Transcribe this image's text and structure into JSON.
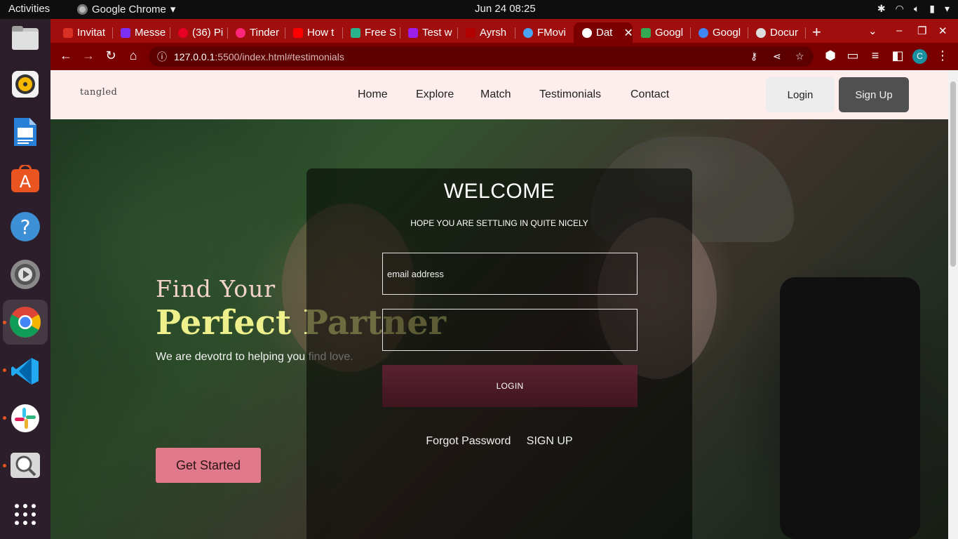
{
  "system": {
    "activities": "Activities",
    "app_name": "Google Chrome",
    "clock": "Jun 24  08:25"
  },
  "dock": [
    {
      "name": "files-icon"
    },
    {
      "name": "rhythmbox-icon"
    },
    {
      "name": "libreoffice-writer-icon"
    },
    {
      "name": "ubuntu-software-icon"
    },
    {
      "name": "help-icon"
    },
    {
      "name": "settings-icon"
    },
    {
      "name": "chrome-icon"
    },
    {
      "name": "vscode-icon"
    },
    {
      "name": "slack-icon"
    },
    {
      "name": "image-viewer-icon"
    },
    {
      "name": "show-apps-icon"
    }
  ],
  "tabs": [
    {
      "label": "Invitat",
      "color": "#d93025"
    },
    {
      "label": "Messe",
      "color": "#7b2ff7"
    },
    {
      "label": "(36) Pi",
      "color": "#e60023"
    },
    {
      "label": "Tinder",
      "color": "#fd267a"
    },
    {
      "label": "How t",
      "color": "#ff0000"
    },
    {
      "label": "Free S",
      "color": "#2bb48c"
    },
    {
      "label": "Test w",
      "color": "#9b1fe8"
    },
    {
      "label": "Ayrsh",
      "color": "#b30000"
    },
    {
      "label": "FMovi",
      "color": "#4aa3f0"
    },
    {
      "label": "Dat",
      "color": "#ffffff"
    },
    {
      "label": "Googl",
      "color": "#34a853"
    },
    {
      "label": "Googl",
      "color": "#4285f4"
    },
    {
      "label": "Docur",
      "color": "#dddddd"
    }
  ],
  "browser": {
    "url_host": "127.0.0.1",
    "url_path": ":5500/index.html#testimonials",
    "profile_initial": "C",
    "accent": "#a00e0e"
  },
  "site": {
    "logo": "tangled",
    "nav": [
      "Home",
      "Explore",
      "Match",
      "Testimonials",
      "Contact"
    ],
    "login_label": "Login",
    "signup_label": "Sign Up"
  },
  "hero": {
    "line1": "Find Your",
    "line2": "Perfect Partner",
    "tagline": "We are devotrd to helping you find love.",
    "cta": "Get Started"
  },
  "login_card": {
    "title": "WELCOME",
    "subtitle": "HOPE YOU ARE SETTLING IN QUITE NICELY",
    "email_placeholder": "email address",
    "password_placeholder": "",
    "button": "LOGIN",
    "forgot": "Forgot Password",
    "signup": "SIGN UP"
  }
}
